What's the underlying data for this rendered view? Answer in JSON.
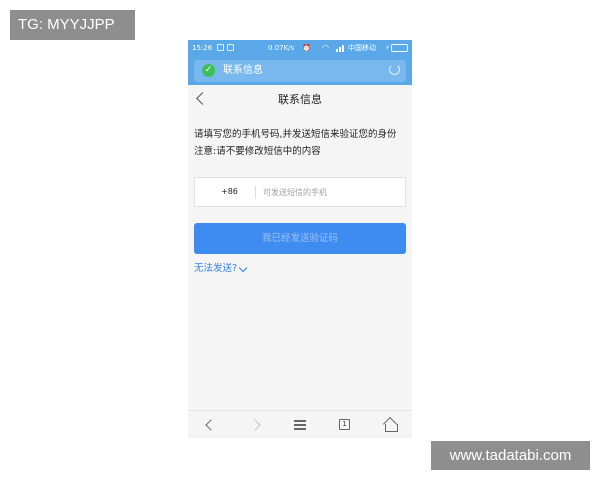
{
  "watermarks": {
    "top_left": "TG: MYYJJPP",
    "bottom_right": "www.tadatabi.com"
  },
  "status_bar": {
    "time": "15:26",
    "network_speed": "0.07K/s",
    "carrier": "中国移动",
    "battery_color": "#7dd15a"
  },
  "app_bar": {
    "title": "联系信息",
    "shield_icon": "check-shield-icon",
    "refresh_icon": "refresh-icon",
    "color": "#5aa8e8"
  },
  "nav": {
    "title": "联系信息",
    "back_icon": "chevron-left-icon"
  },
  "instructions": {
    "line1": "请填写您的手机号码,并发送短信来验证您的身份",
    "line2": "注意:请不要修改短信中的内容"
  },
  "phone_form": {
    "country_code": "+86",
    "placeholder": "可发送短信的手机",
    "value": ""
  },
  "send_button": {
    "label": "我已经发送验证码",
    "color": "#3f8cf0"
  },
  "cant_send_link": {
    "label": "无法发送?",
    "color": "#2f7fe6"
  },
  "bottom_bar": {
    "tab_count": "1",
    "icons": [
      "back-icon",
      "forward-icon",
      "menu-icon",
      "tabs-icon",
      "home-icon"
    ]
  }
}
